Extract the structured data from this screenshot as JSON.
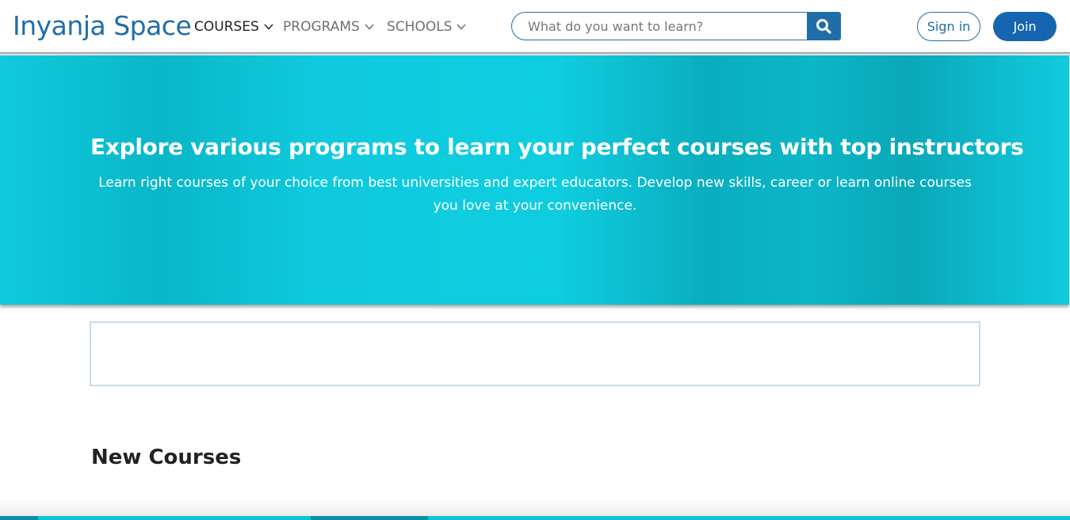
{
  "header": {
    "logo": "Inyanja Space",
    "nav": {
      "courses": "COURSES",
      "programs": "PROGRAMS",
      "schools": "SCHOOLS"
    },
    "search": {
      "placeholder": "What do you want to learn?",
      "value": ""
    },
    "sign_in": "Sign in",
    "join": "Join"
  },
  "hero": {
    "title": "Explore various programs to learn your perfect courses with top instructors",
    "subtitle": "Learn right courses of your choice from best universities and expert educators. Develop new skills, career or learn online courses you love at your convenience."
  },
  "sections": {
    "new_courses": "New Courses"
  },
  "colors": {
    "brand": "#1f6ea8",
    "join_button": "#1565b0",
    "hero_accent": "#0fcde0"
  },
  "icons": {
    "search": "search-icon",
    "dropdown": "chevron-down-icon"
  }
}
